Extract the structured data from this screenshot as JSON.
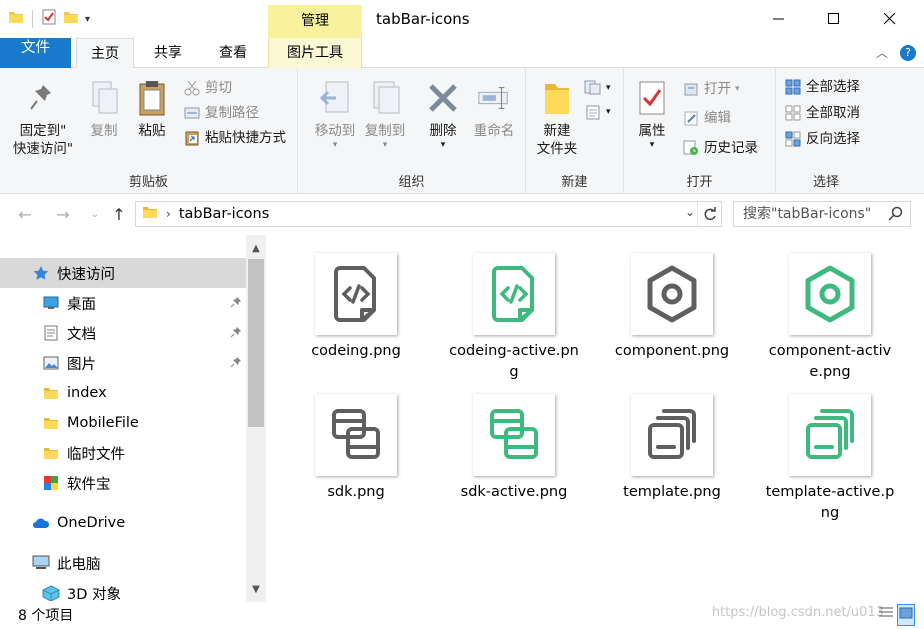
{
  "window": {
    "title": "tabBar-icons",
    "context_tab_title": "管理"
  },
  "tabs": {
    "file": "文件",
    "home": "主页",
    "share": "共享",
    "view": "查看",
    "picture_tools": "图片工具"
  },
  "ribbon": {
    "clipboard": {
      "label": "剪贴板",
      "pin": "固定到\"\n快速访问\"",
      "pin_l1": "固定到\"",
      "pin_l2": "快速访问\"",
      "copy": "复制",
      "paste": "粘贴",
      "cut": "剪切",
      "copy_path": "复制路径",
      "paste_shortcut": "粘贴快捷方式"
    },
    "organize": {
      "label": "组织",
      "move_to": "移动到",
      "copy_to": "复制到",
      "delete": "删除",
      "rename": "重命名"
    },
    "new": {
      "label": "新建",
      "new_folder_l1": "新建",
      "new_folder_l2": "文件夹"
    },
    "open": {
      "label": "打开",
      "properties": "属性",
      "open": "打开",
      "edit": "编辑",
      "history": "历史记录"
    },
    "select": {
      "label": "选择",
      "select_all": "全部选择",
      "select_none": "全部取消",
      "invert": "反向选择"
    }
  },
  "address": {
    "path": "tabBar-icons",
    "search_placeholder": "搜索\"tabBar-icons\""
  },
  "nav": [
    {
      "label": "快速访问",
      "icon": "star-icon",
      "selected": true,
      "pinned": false
    },
    {
      "label": "桌面",
      "icon": "desktop-icon",
      "pinned": true
    },
    {
      "label": "文档",
      "icon": "document-icon",
      "pinned": true
    },
    {
      "label": "图片",
      "icon": "picture-icon",
      "pinned": true
    },
    {
      "label": "index",
      "icon": "folder-icon"
    },
    {
      "label": "MobileFile",
      "icon": "folder-icon"
    },
    {
      "label": "临时文件",
      "icon": "folder-icon"
    },
    {
      "label": "软件宝",
      "icon": "app-icon"
    },
    {
      "label": "OneDrive",
      "icon": "cloud-icon"
    },
    {
      "label": "此电脑",
      "icon": "computer-icon"
    },
    {
      "label": "3D 对象",
      "icon": "cube-icon"
    }
  ],
  "files": [
    {
      "name": "codeing.png",
      "icon": "code-file-icon",
      "color": "#5f5f5f"
    },
    {
      "name": "codeing-active.png",
      "icon": "code-file-icon",
      "color": "#3dba7e"
    },
    {
      "name": "component.png",
      "icon": "hexagon-icon",
      "color": "#5f5f5f"
    },
    {
      "name": "component-active.png",
      "icon": "hexagon-icon",
      "color": "#3dba7e"
    },
    {
      "name": "sdk.png",
      "icon": "sdk-icon",
      "color": "#5f5f5f"
    },
    {
      "name": "sdk-active.png",
      "icon": "sdk-icon",
      "color": "#3dba7e"
    },
    {
      "name": "template.png",
      "icon": "template-icon",
      "color": "#5f5f5f"
    },
    {
      "name": "template-active.png",
      "icon": "template-icon",
      "color": "#3dba7e"
    }
  ],
  "status": {
    "count": "8 个项目",
    "watermark": "https://blog.csdn.net/u013"
  },
  "colors": {
    "accent": "#1979ca",
    "context_tab": "#f8f29f",
    "icon_gray": "#5f5f5f",
    "icon_green": "#3dba7e"
  }
}
